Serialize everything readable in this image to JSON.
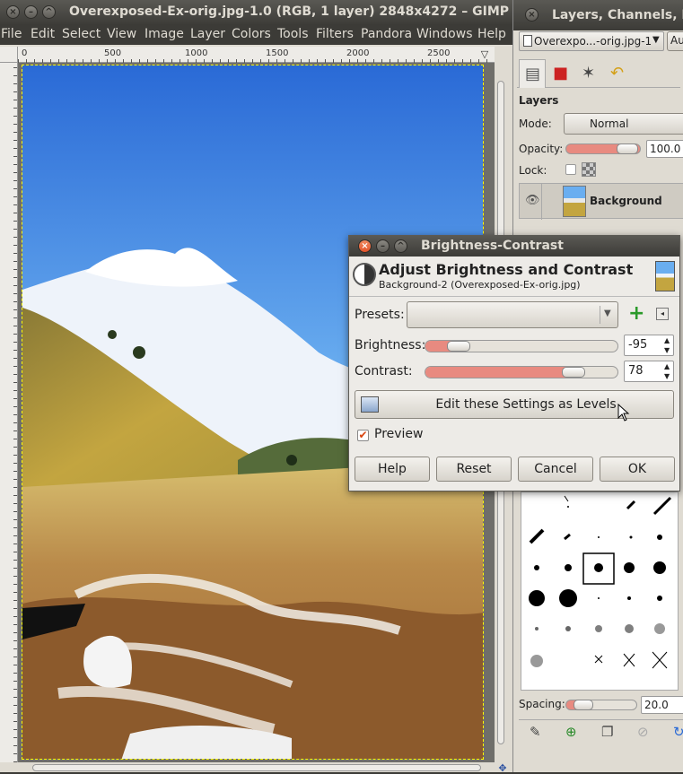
{
  "main_window": {
    "title": "Overexposed-Ex-orig.jpg-1.0 (RGB, 1 layer) 2848x4272 – GIMP",
    "menu": [
      "File",
      "Edit",
      "Select",
      "View",
      "Image",
      "Layer",
      "Colors",
      "Tools",
      "Filters",
      "Pandora",
      "Windows",
      "Help"
    ],
    "ruler_ticks": [
      "0",
      "500",
      "1000",
      "1500",
      "2000",
      "2500"
    ]
  },
  "dock": {
    "title": "Layers, Channels, P",
    "image_select": "Overexpo...-orig.jpg-1",
    "auto_label": "Au",
    "layers_heading": "Layers",
    "mode_label": "Mode:",
    "mode_value": "Normal",
    "opacity_label": "Opacity:",
    "opacity_value": "100.0",
    "lock_label": "Lock:",
    "layer_name": "Background",
    "spacing_label": "Spacing:",
    "spacing_value": "20.0"
  },
  "dialog": {
    "title": "Brightness-Contrast",
    "heading": "Adjust Brightness and Contrast",
    "subheading": "Background-2 (Overexposed-Ex-orig.jpg)",
    "presets_label": "Presets:",
    "brightness_label": "Brightness:",
    "brightness_value": "-95",
    "brightness_level": -95,
    "contrast_label": "Contrast:",
    "contrast_value": "78",
    "contrast_level": 78,
    "levels_button": "Edit these Settings as Levels",
    "preview_label": "Preview",
    "preview_checked": true,
    "help_button": "Help",
    "reset_button": "Reset",
    "cancel_button": "Cancel",
    "ok_button": "OK"
  },
  "colors": {
    "titlebar": "#3c3b37",
    "close_button": "#e2532a",
    "slider_fill": "#e88a80",
    "panel": "#dfdbd2"
  }
}
